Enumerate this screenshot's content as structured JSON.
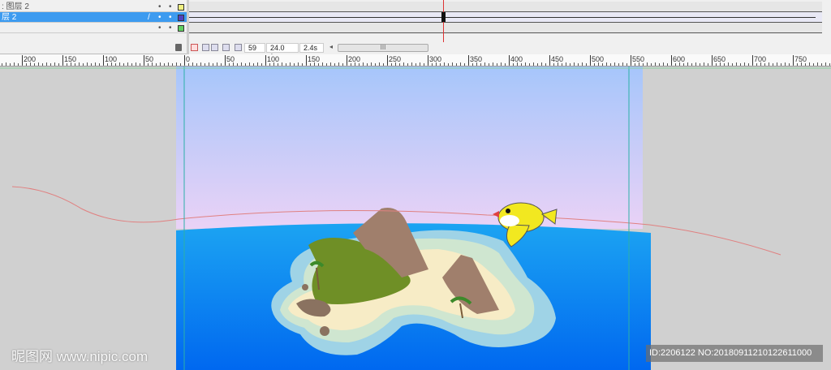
{
  "timeline": {
    "layers": [
      {
        "name": ": 图层 2",
        "color": "#f0f080",
        "selected": false
      },
      {
        "name": "层 2",
        "color": "#5040c0",
        "selected": true
      },
      {
        "name": "",
        "color": "#60d060",
        "selected": false
      }
    ],
    "current_frame": "59",
    "fps": "24.0 fps",
    "time": "2.4s",
    "scroll_thumb": "III"
  },
  "ruler": {
    "labels": [
      "200",
      "150",
      "100",
      "50",
      "0",
      "50",
      "100",
      "150",
      "200",
      "250",
      "300",
      "350",
      "400",
      "450",
      "500",
      "550",
      "600",
      "650",
      "700",
      "750"
    ]
  },
  "watermark": {
    "site": "昵图网 www.nipic.com",
    "id": "ID:2206122 NO:20180911210122611000"
  }
}
